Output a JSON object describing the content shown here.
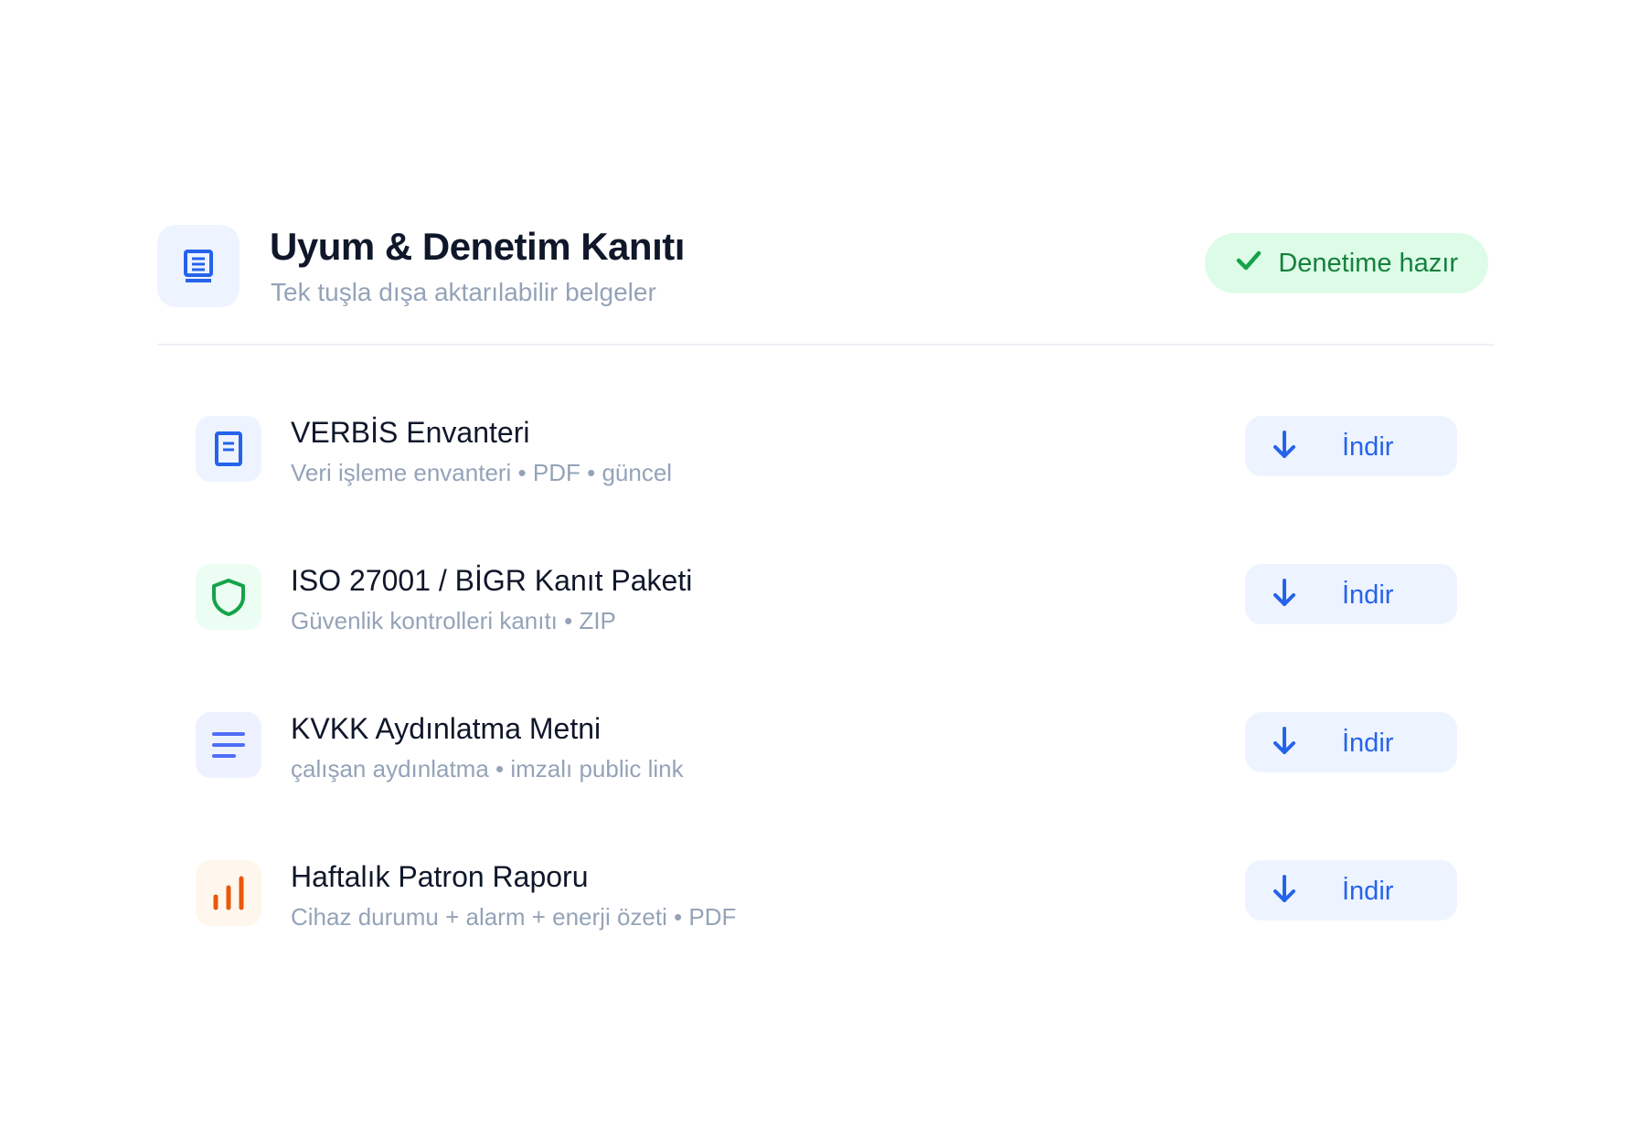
{
  "header": {
    "icon": "document-stack-icon",
    "title": "Uyum & Denetim Kanıtı",
    "subtitle": "Tek tuşla dışa aktarılabilir belgeler",
    "status": {
      "icon": "check-icon",
      "label": "Denetime hazır",
      "color": "#15803d",
      "background": "#dcfce7"
    }
  },
  "documents": [
    {
      "title": "VERBİS Envanteri",
      "description": "Veri işleme envanteri • PDF • güncel",
      "icon": "document-icon",
      "accent": "#2563eb",
      "icon_bg": "#eef4ff",
      "action": "İndir"
    },
    {
      "title": "ISO 27001 / BİGR Kanıt Paketi",
      "description": "Güvenlik kontrolleri kanıtı • ZIP",
      "icon": "shield-icon",
      "accent": "#16a34a",
      "icon_bg": "#ecfdf3",
      "action": "İndir"
    },
    {
      "title": "KVKK Aydınlatma Metni",
      "description": "çalışan aydınlatma • imzalı public link",
      "icon": "text-lines-icon",
      "accent": "#4f6ef7",
      "icon_bg": "#eef2ff",
      "action": "İndir"
    },
    {
      "title": "Haftalık Patron Raporu",
      "description": "Cihaz durumu + alarm + enerji özeti • PDF",
      "icon": "bar-chart-icon",
      "accent": "#ea580c",
      "icon_bg": "#fff7ed",
      "action": "İndir"
    }
  ]
}
